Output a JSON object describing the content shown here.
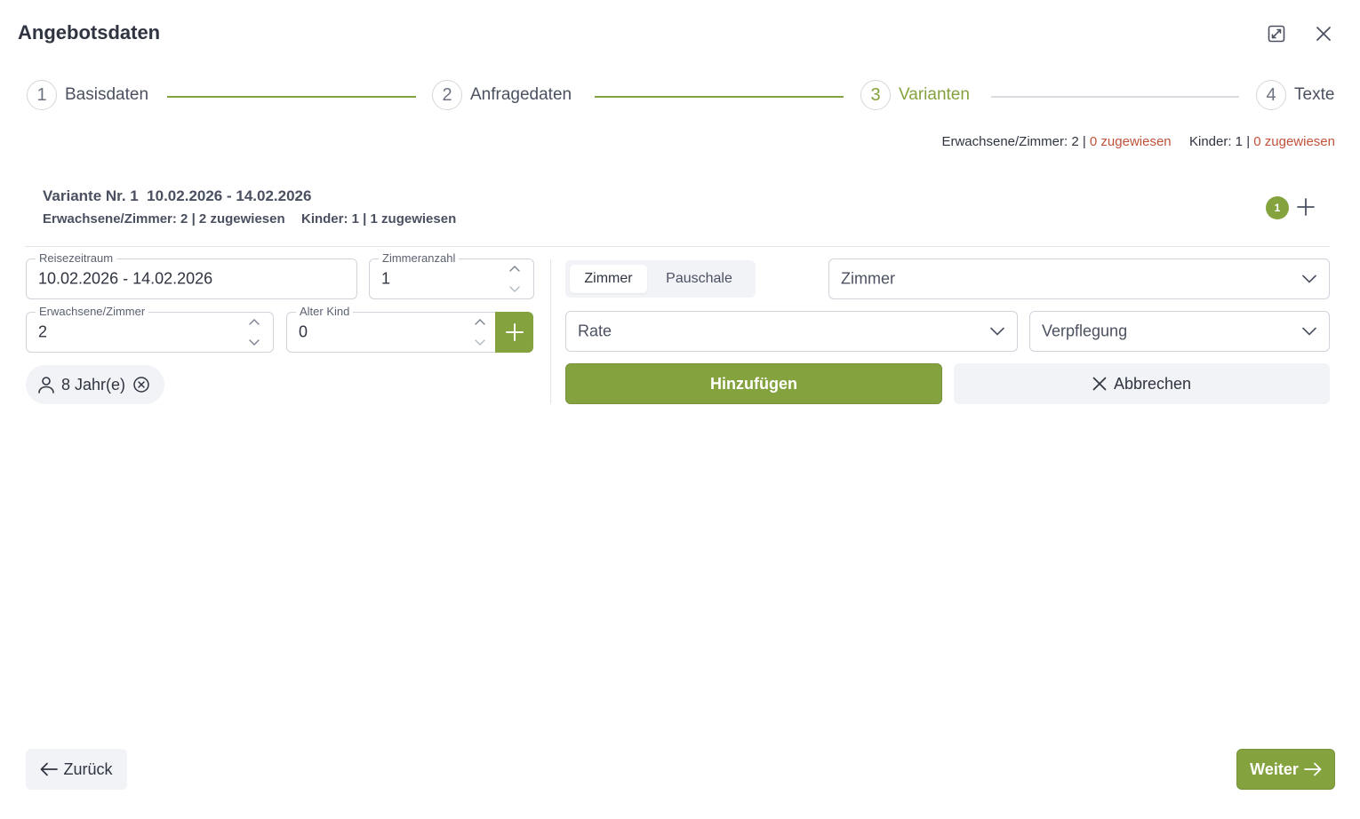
{
  "dialog": {
    "title": "Angebotsdaten"
  },
  "stepper": {
    "steps": [
      {
        "number": "1",
        "label": "Basisdaten"
      },
      {
        "number": "2",
        "label": "Anfragedaten"
      },
      {
        "number": "3",
        "label": "Varianten"
      },
      {
        "number": "4",
        "label": "Texte"
      }
    ],
    "active_step": 3
  },
  "summary": {
    "adults_label": "Erwachsene/Zimmer: 2 |",
    "adults_assigned": "0 zugewiesen",
    "kids_label": "Kinder: 1 |",
    "kids_assigned": "0 zugewiesen"
  },
  "variant": {
    "title": "Variante Nr. 1  10.02.2026 - 14.02.2026",
    "subtitle_adults": "Erwachsene/Zimmer: 2 | 2 zugewiesen",
    "subtitle_kids": "Kinder: 1 | 1 zugewiesen",
    "badge": "1"
  },
  "form": {
    "travel_period": {
      "label": "Reisezeitraum",
      "value": "10.02.2026 - 14.02.2026"
    },
    "room_count": {
      "label": "Zimmeranzahl",
      "value": "1"
    },
    "adults_per_room": {
      "label": "Erwachsene/Zimmer",
      "value": "2"
    },
    "child_age": {
      "label": "Alter Kind",
      "value": "0"
    },
    "child_chip": "8 Jahr(e)"
  },
  "room_type_toggle": {
    "options": [
      "Zimmer",
      "Pauschale"
    ],
    "selected": "Zimmer"
  },
  "selects": {
    "room": "Zimmer",
    "rate": "Rate",
    "board": "Verpflegung"
  },
  "buttons": {
    "add": "Hinzufügen",
    "cancel": "Abbrechen",
    "back": "Zurück",
    "next": "Weiter"
  },
  "colors": {
    "accent": "#84a33e",
    "warning": "#c0523a"
  }
}
